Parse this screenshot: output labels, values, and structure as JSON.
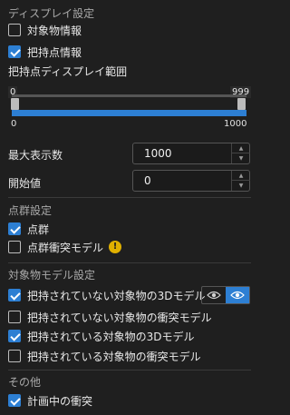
{
  "display_settings": {
    "title": "ディスプレイ設定",
    "object_info": {
      "label": "対象物情報",
      "checked": false
    },
    "grasp_info": {
      "label": "把持点情報",
      "checked": true
    },
    "grasp_range": {
      "title": "把持点ディスプレイ範囲",
      "lower_value": "0",
      "upper_value": "999",
      "min_label": "0",
      "max_label": "1000"
    },
    "max_display": {
      "label": "最大表示数",
      "value": "1000"
    },
    "start_value": {
      "label": "開始値",
      "value": "0"
    }
  },
  "point_cloud": {
    "title": "点群設定",
    "point_cloud": {
      "label": "点群",
      "checked": true
    },
    "collision_model": {
      "label": "点群衝突モデル",
      "checked": false,
      "warning_icon": "warning-icon"
    }
  },
  "object_model": {
    "title": "対象物モデル設定",
    "items": [
      {
        "label": "把持されていない対象物の3Dモデル",
        "checked": true
      },
      {
        "label": "把持されていない対象物の衝突モデル",
        "checked": false
      },
      {
        "label": "把持されている対象物の3Dモデル",
        "checked": true
      },
      {
        "label": "把持されている対象物の衝突モデル",
        "checked": false
      }
    ],
    "eye_buttons": [
      "eye-icon",
      "eye-icon"
    ]
  },
  "other": {
    "title": "その他",
    "collision_in_plan": {
      "label": "計画中の衝突",
      "checked": true
    }
  },
  "colors": {
    "accent": "#2d7fd3",
    "background": "#1f1f1f",
    "warning": "#e0b000"
  }
}
